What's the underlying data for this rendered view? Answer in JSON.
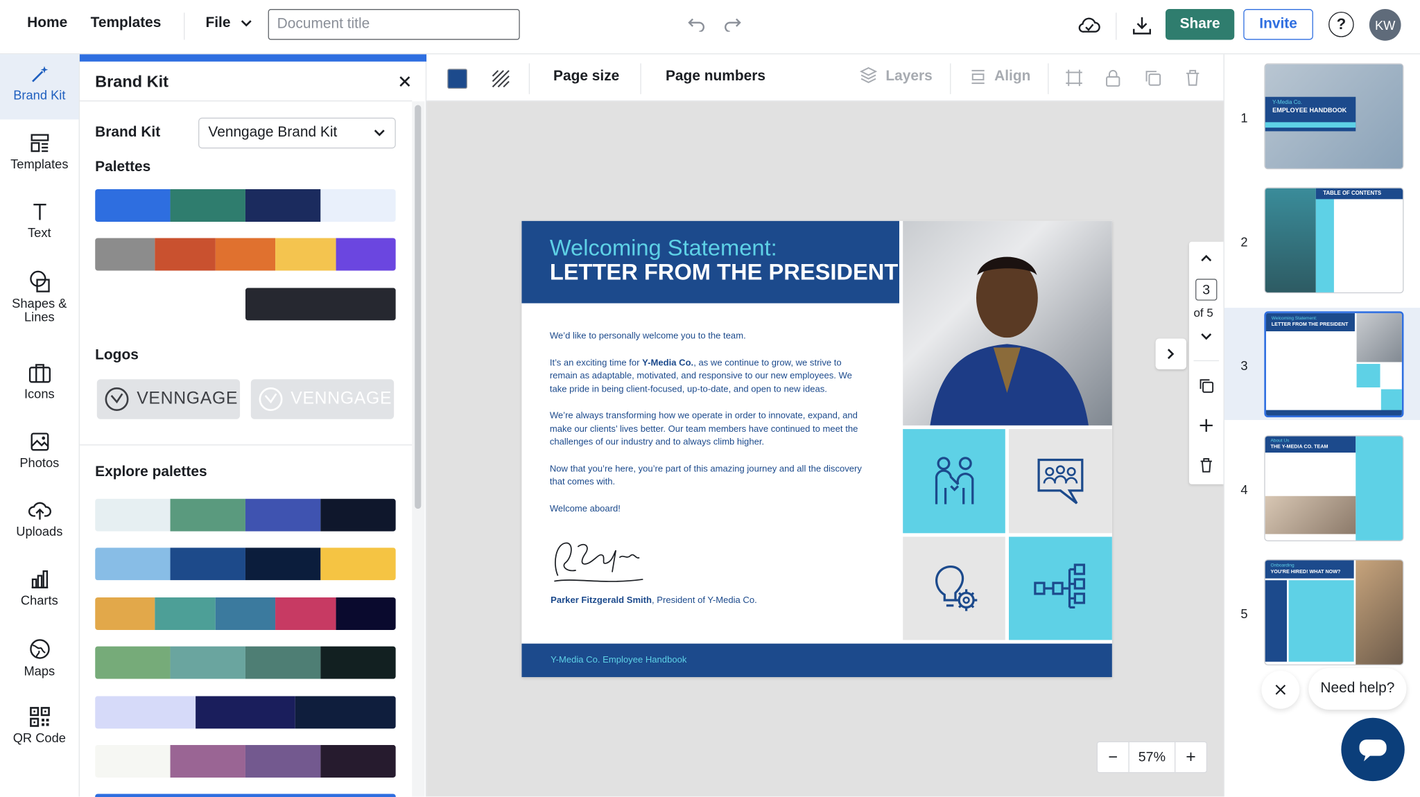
{
  "topbar": {
    "home": "Home",
    "templates": "Templates",
    "file": "File",
    "title_placeholder": "Document title",
    "share": "Share",
    "invite": "Invite",
    "help": "?",
    "avatar": "KW"
  },
  "rail": [
    {
      "label": "Brand Kit",
      "icon": "magic-wand-icon"
    },
    {
      "label": "Templates",
      "icon": "templates-icon"
    },
    {
      "label": "Text",
      "icon": "text-icon"
    },
    {
      "label": "Shapes &",
      "label2": "Lines",
      "icon": "shapes-icon"
    },
    {
      "label": "Icons",
      "icon": "icons-icon"
    },
    {
      "label": "Photos",
      "icon": "photo-icon"
    },
    {
      "label": "Uploads",
      "icon": "upload-icon"
    },
    {
      "label": "Charts",
      "icon": "chart-icon"
    },
    {
      "label": "Maps",
      "icon": "globe-icon"
    },
    {
      "label": "QR Code",
      "icon": "qr-code-icon"
    }
  ],
  "panel": {
    "title": "Brand Kit",
    "brand_kit_label": "Brand Kit",
    "brand_kit_value": "Venngage Brand Kit",
    "palettes_label": "Palettes",
    "brand_palettes": [
      [
        "#2e6ee0",
        "#2f7d6e",
        "#1b2b5e",
        "#e9f0fb"
      ],
      [
        "#8c8c8c",
        "#c9512f",
        "#e0712f",
        "#f4c44f",
        "#6b46e0"
      ],
      [
        "#262830"
      ]
    ],
    "logos_label": "Logos",
    "logos": [
      "VENNGAGE",
      "VENNGAGE"
    ],
    "explore_label": "Explore palettes",
    "explore_palettes": [
      [
        "#e6eff2",
        "#5a9a7e",
        "#3f53b0",
        "#0f172c"
      ],
      [
        "#88bde6",
        "#1d4a8a",
        "#0b1d3c",
        "#f5c443"
      ],
      [
        "#e2a84a",
        "#4d9f97",
        "#3b7a9e",
        "#c73a63",
        "#0a0a2e"
      ],
      [
        "#76ab79",
        "#6aa59f",
        "#4e7e74",
        "#122021"
      ],
      [
        "#d6daf9",
        "#1a1e5c",
        "#0f1e3d"
      ],
      [
        "#f6f7f3",
        "#9a6594",
        "#73598f",
        "#261b2e"
      ]
    ]
  },
  "canvas_toolbar": {
    "page_size": "Page size",
    "page_numbers": "Page numbers",
    "layers": "Layers",
    "align": "Align",
    "fill_color": "#1c4a8c"
  },
  "page": {
    "heading1": "Welcoming Statement:",
    "heading2": "LETTER FROM THE PRESIDENT",
    "p1": "We’d like to personally welcome you to the team.",
    "p2_a": "It’s an exciting time for ",
    "p2_b": "Y-Media Co.",
    "p2_c": ", as we continue to grow, we strive to remain as adaptable, motivated, and responsive to our new employees. We take pride in being client-focused, up-to-date, and open to new ideas.",
    "p3": "We’re always transforming how we operate in order to innovate, expand, and make our clients’ lives better. Our team members have continued to meet the challenges of our industry and to always climb higher.",
    "p4": "Now that you’re here, you’re part of this amazing journey and all the discovery that comes with.",
    "p5": "Welcome aboard!",
    "signer_name": "Parker Fitzgerald Smith",
    "signer_title": ", President of Y-Media Co.",
    "footer": "Y-Media Co. Employee Handbook"
  },
  "page_nav": {
    "current": "3",
    "of": "of 5"
  },
  "zoom": {
    "minus": "−",
    "value": "57%",
    "plus": "+"
  },
  "thumbnails": [
    {
      "num": "1",
      "title": "EMPLOYEE HANDBOOK",
      "sub": "Y-Media Co."
    },
    {
      "num": "2",
      "title": "TABLE OF CONTENTS"
    },
    {
      "num": "3",
      "title": "LETTER FROM THE PRESIDENT",
      "sub": "Welcoming Statement:"
    },
    {
      "num": "4",
      "title": "THE Y-MEDIA CO. TEAM",
      "sub": "About Us"
    },
    {
      "num": "5",
      "title": "YOU'RE HIRED! WHAT NOW?",
      "sub": "Onboarding"
    }
  ],
  "help": {
    "text": "Need help?"
  }
}
